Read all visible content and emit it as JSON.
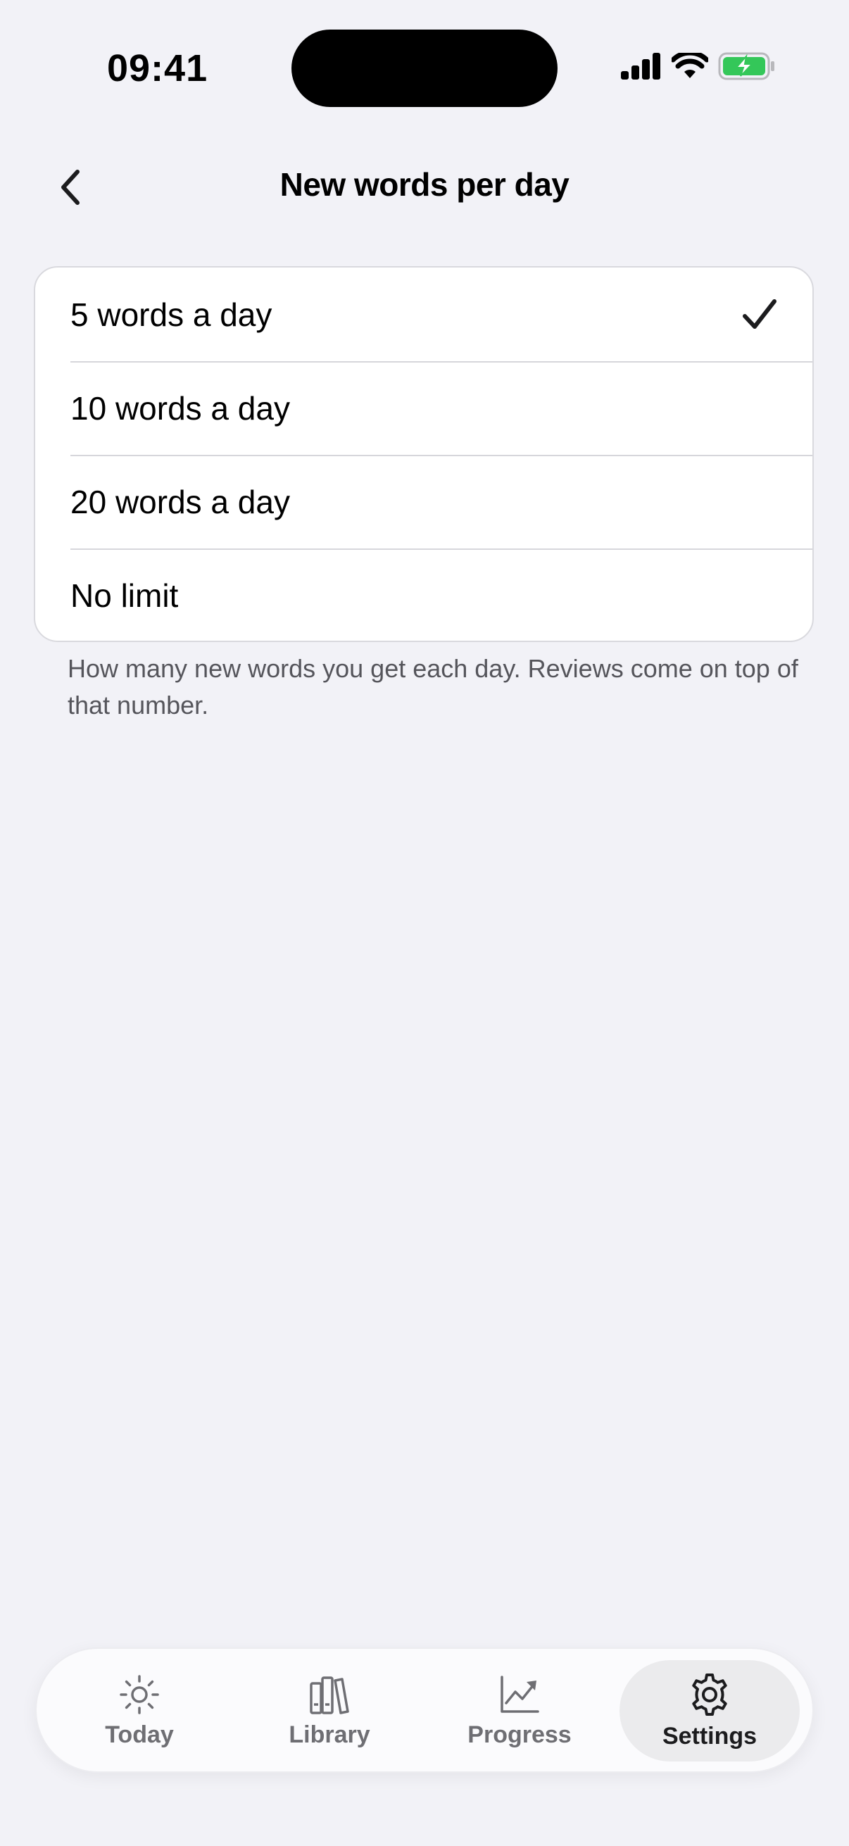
{
  "status_bar": {
    "time": "09:41"
  },
  "header": {
    "title": "New words per day"
  },
  "options": [
    {
      "label": "5 words a day",
      "selected": true
    },
    {
      "label": "10 words a day",
      "selected": false
    },
    {
      "label": "20 words a day",
      "selected": false
    },
    {
      "label": "No limit",
      "selected": false
    }
  ],
  "helper_text": "How many new words you get each day. Reviews come on top of that number.",
  "tab_bar": {
    "tabs": [
      {
        "label": "Today",
        "icon": "sun-icon",
        "active": false
      },
      {
        "label": "Library",
        "icon": "books-icon",
        "active": false
      },
      {
        "label": "Progress",
        "icon": "chart-icon",
        "active": false
      },
      {
        "label": "Settings",
        "icon": "gear-icon",
        "active": true
      }
    ]
  },
  "colors": {
    "background": "#f2f2f7",
    "battery_green": "#34c759",
    "active_tab_bg": "#ebebed"
  }
}
